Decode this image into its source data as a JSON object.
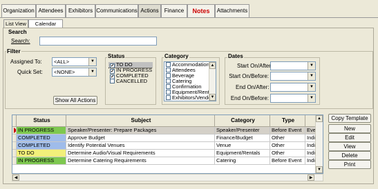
{
  "tabs": [
    {
      "label": "Organization",
      "state": "normal"
    },
    {
      "label": "Attendees",
      "state": "normal"
    },
    {
      "label": "Exhibitors",
      "state": "normal"
    },
    {
      "label": "Communications",
      "state": "normal"
    },
    {
      "label": "Actions",
      "state": "active"
    },
    {
      "label": "Finance",
      "state": "normal"
    },
    {
      "label": "Notes",
      "state": "alert"
    },
    {
      "label": "Attachments",
      "state": "normal"
    }
  ],
  "subtabs": {
    "list": "List View",
    "calendar": "Calendar View"
  },
  "search": {
    "heading": "Search",
    "label": "Search:",
    "value": ""
  },
  "filter": {
    "heading": "Filter",
    "assigned_label": "Assigned To:",
    "assigned_value": "<ALL>",
    "quickset_label": "Quick Set:",
    "quickset_value": "<NONE>",
    "show_all": "Show All Actions"
  },
  "status": {
    "heading": "Status",
    "items": [
      {
        "label": "TO DO",
        "checked": "✔",
        "selected": true
      },
      {
        "label": "IN PROGRESS",
        "checked": "✔",
        "selected": false
      },
      {
        "label": "COMPLETED",
        "checked": "✔",
        "selected": false
      },
      {
        "label": "CANCELLED",
        "checked": "",
        "selected": false
      }
    ]
  },
  "category": {
    "heading": "Category",
    "items": [
      "Accommodation",
      "Attendees",
      "Beverage",
      "Catering",
      "Confirmation",
      "Equipment/Rentals",
      "Exhibitors/Vendors"
    ]
  },
  "dates": {
    "heading": "Dates",
    "start_after": "Start On/After:",
    "start_before": "Start On/Before:",
    "end_after": "End On/After:",
    "end_before": "End On/Before:"
  },
  "grid": {
    "columns": [
      "Status",
      "Subject",
      "Category",
      "Type"
    ],
    "rows": [
      {
        "status": "IN PROGRESS",
        "status_color": "#7ec850",
        "subject": "Speaker/Presenter: Prepare Packages",
        "category": "Speaker/Presenter",
        "type": "Before Event",
        "extra": "Ever"
      },
      {
        "status": "COMPLETED",
        "status_color": "#9fbcea",
        "subject": "Approve Budget",
        "category": "Finance/Budget",
        "type": "Other",
        "extra": "Indiv"
      },
      {
        "status": "COMPLETED",
        "status_color": "#9fbcea",
        "subject": "Identify Potential Venues",
        "category": "Venue",
        "type": "Other",
        "extra": "Indiv"
      },
      {
        "status": "TO DO",
        "status_color": "#f2f07a",
        "subject": "Determine Audio/Visual Requirements",
        "category": "Equipment/Rentals",
        "type": "Other",
        "extra": "Indiv"
      },
      {
        "status": "IN PROGRESS",
        "status_color": "#7ec850",
        "subject": "Determine Catering Requirements",
        "category": "Catering",
        "type": "Before Event",
        "extra": "Indiv"
      }
    ]
  },
  "buttons": {
    "copy_template": "Copy Template",
    "new": "New",
    "edit": "Edit",
    "view": "View",
    "delete": "Delete",
    "print": "Print"
  },
  "icons": {
    "pointer": "row-pointer-icon",
    "arrows": "scroll-arrow-icon"
  }
}
